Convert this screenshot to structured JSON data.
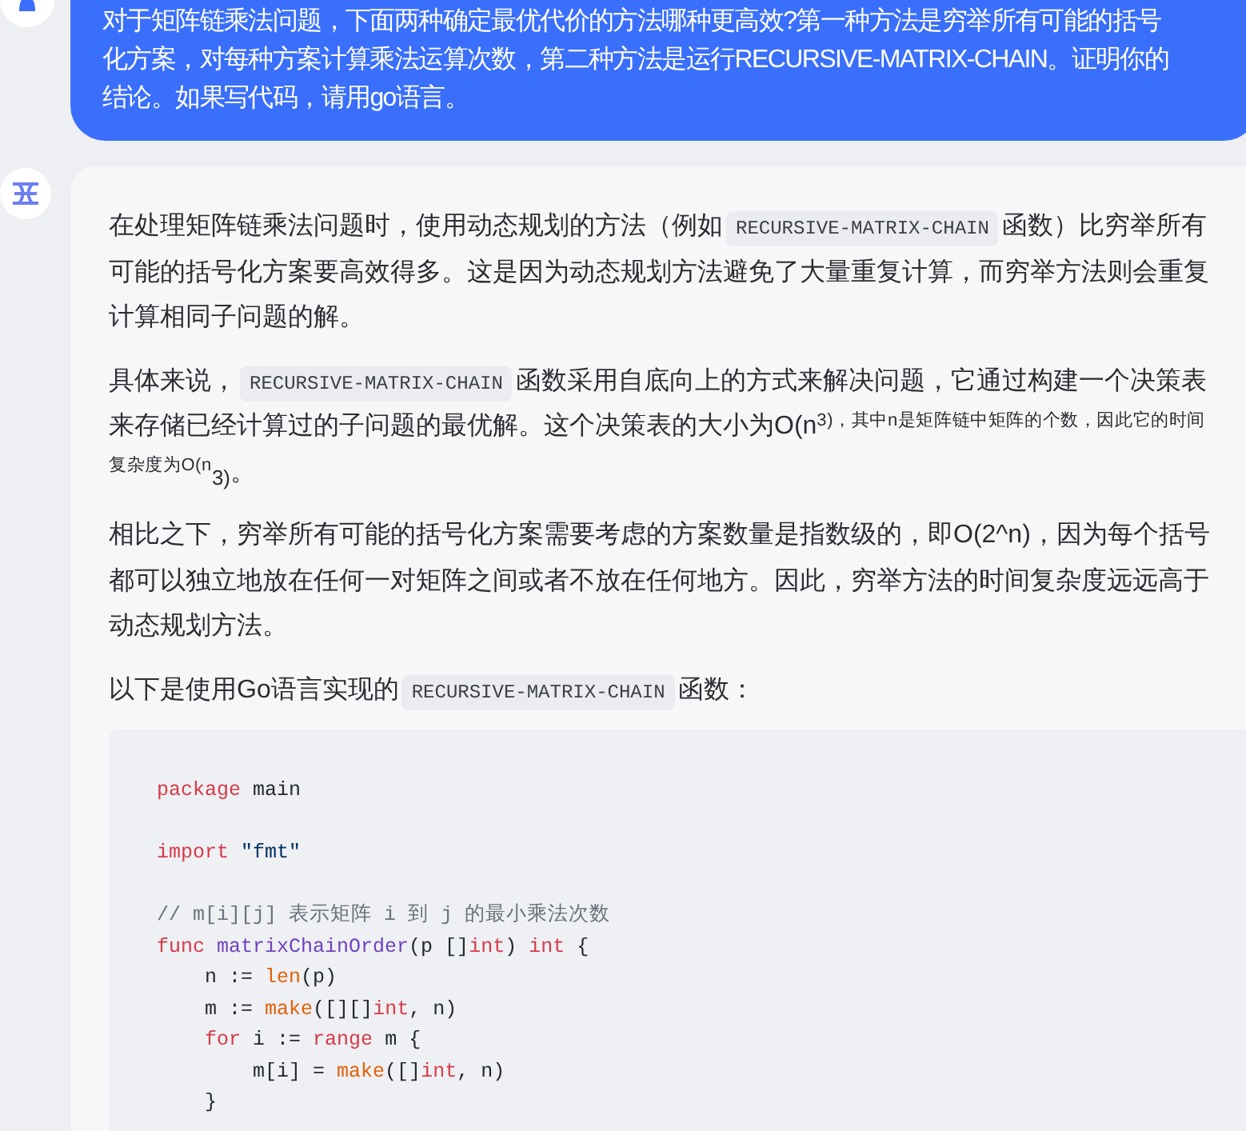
{
  "user_message": {
    "text": "对于矩阵链乘法问题，下面两种确定最优代价的方法哪种更高效?第一种方法是穷举所有可能的括号化方案，对每种方案计算乘法运算次数，第二种方法是运行RECURSIVE-MATRIX-CHAIN。证明你的结论。如果写代码，请用go语言。"
  },
  "assistant_message": {
    "blocks": [
      {
        "kind": "paragraph",
        "segments": [
          {
            "kind": "text",
            "text": "在处理矩阵链乘法问题时，使用动态规划的方法（例如"
          },
          {
            "kind": "code",
            "text": "RECURSIVE-MATRIX-CHAIN"
          },
          {
            "kind": "text",
            "text": "函数）比穷举所有可能的括号化方案要高效得多。这是因为动态规划方法避免了大量重复计算，而穷举方法则会重复计算相同子问题的解。"
          }
        ]
      },
      {
        "kind": "paragraph",
        "segments": [
          {
            "kind": "text",
            "text": "具体来说，"
          },
          {
            "kind": "code",
            "text": "RECURSIVE-MATRIX-CHAIN"
          },
          {
            "kind": "text",
            "text": "函数采用自底向上的方式来解决问题，它通过构建一个决策表来存储已经计算过的子问题的最优解。这个决策表的大小为O(n$^{3)，其中n是矩阵链中矩阵的个数，因此它的时间复杂度为O(n}$$_{3)}$。"
          }
        ]
      },
      {
        "kind": "paragraph",
        "segments": [
          {
            "kind": "text",
            "text": "相比之下，穷举所有可能的括号化方案需要考虑的方案数量是指数级的，即O(2^n)，因为每个括号都可以独立地放在任何一对矩阵之间或者不放在任何地方。因此，穷举方法的时间复杂度远远高于动态规划方法。"
          }
        ]
      },
      {
        "kind": "paragraph",
        "segments": [
          {
            "kind": "text",
            "text": "以下是使用Go语言实现的"
          },
          {
            "kind": "code",
            "text": "RECURSIVE-MATRIX-CHAIN"
          },
          {
            "kind": "text",
            "text": "函数："
          }
        ]
      },
      {
        "kind": "code_block",
        "lines": [
          {
            "kind": "code",
            "tokens": [
              {
                "kind": "keyword",
                "text": "package"
              },
              {
                "kind": "plain",
                "text": " main"
              }
            ]
          },
          {
            "kind": "blank"
          },
          {
            "kind": "code",
            "tokens": [
              {
                "kind": "keyword",
                "text": "import"
              },
              {
                "kind": "string",
                "text": " \"fmt\""
              }
            ]
          },
          {
            "kind": "blank"
          },
          {
            "kind": "code",
            "tokens": [
              {
                "kind": "comment",
                "text": "// m[i][j] 表示矩阵 i 到 j 的最小乘法次数"
              }
            ]
          },
          {
            "kind": "code",
            "tokens": [
              {
                "kind": "keyword",
                "text": "func"
              },
              {
                "kind": "function",
                "text": " matrixChainOrder"
              },
              {
                "kind": "plain",
                "text": "(p []"
              },
              {
                "kind": "keyword",
                "text": "int"
              },
              {
                "kind": "plain",
                "text": ") "
              },
              {
                "kind": "keyword",
                "text": "int"
              },
              {
                "kind": "plain",
                "text": " {"
              }
            ]
          },
          {
            "kind": "code",
            "tokens": [
              {
                "kind": "plain",
                "text": "    n := "
              },
              {
                "kind": "builtin",
                "text": "len"
              },
              {
                "kind": "plain",
                "text": "(p)"
              }
            ]
          },
          {
            "kind": "code",
            "tokens": [
              {
                "kind": "plain",
                "text": "    m := "
              },
              {
                "kind": "builtin",
                "text": "make"
              },
              {
                "kind": "plain",
                "text": "([][]"
              },
              {
                "kind": "keyword",
                "text": "int"
              },
              {
                "kind": "plain",
                "text": ", n)"
              }
            ]
          },
          {
            "kind": "code",
            "tokens": [
              {
                "kind": "keyword",
                "text": "    for"
              },
              {
                "kind": "plain",
                "text": " i := "
              },
              {
                "kind": "keyword",
                "text": "range"
              },
              {
                "kind": "plain",
                "text": " m {"
              }
            ]
          },
          {
            "kind": "code",
            "tokens": [
              {
                "kind": "plain",
                "text": "        m[i] = "
              },
              {
                "kind": "builtin",
                "text": "make"
              },
              {
                "kind": "plain",
                "text": "([]"
              },
              {
                "kind": "keyword",
                "text": "int"
              },
              {
                "kind": "plain",
                "text": ", n)"
              }
            ]
          },
          {
            "kind": "code",
            "tokens": [
              {
                "kind": "plain",
                "text": "    }"
              }
            ]
          }
        ]
      }
    ]
  }
}
